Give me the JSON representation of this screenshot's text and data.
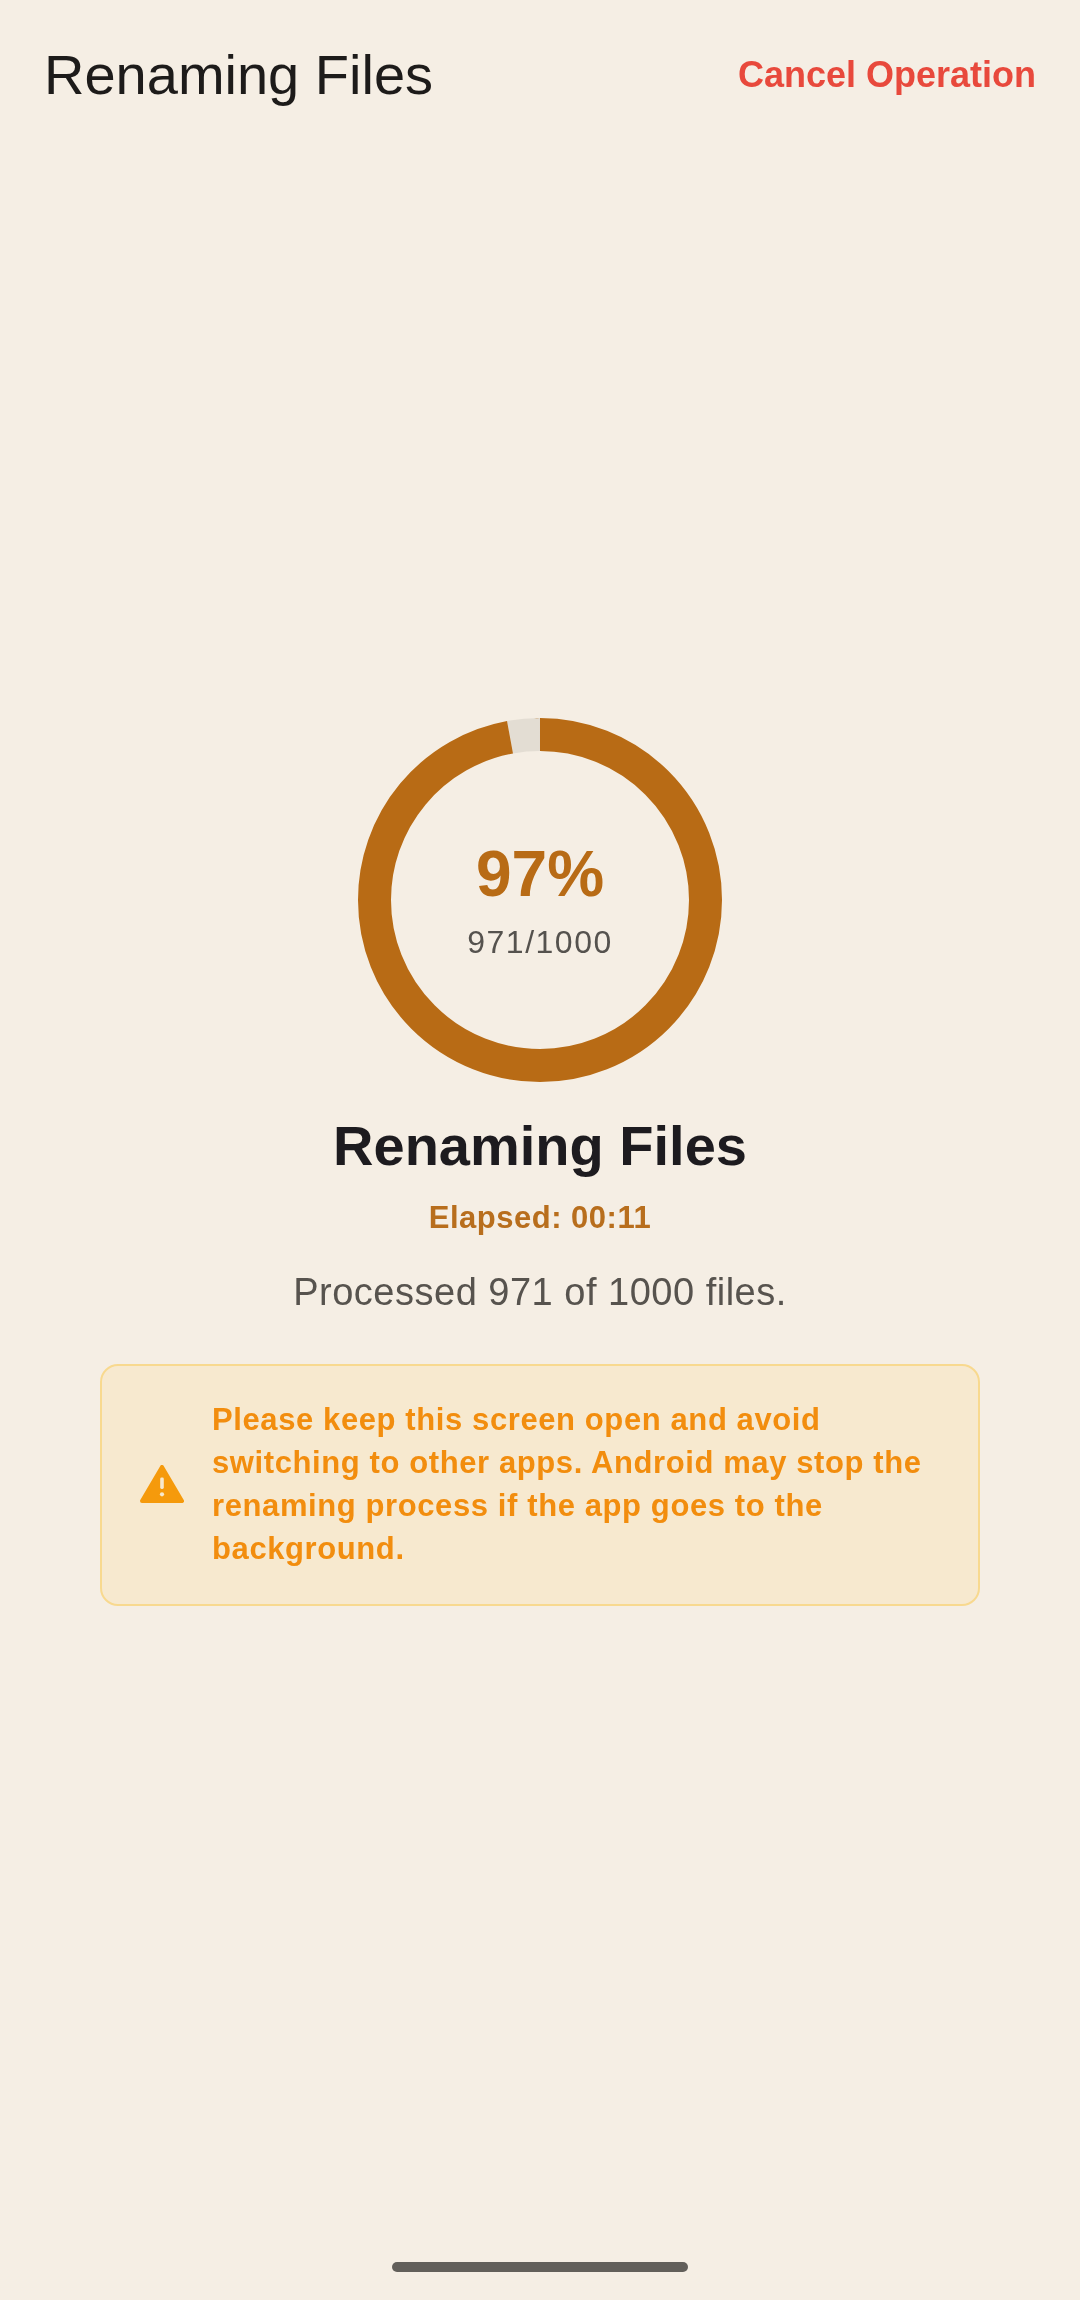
{
  "app_bar": {
    "title": "Renaming Files",
    "cancel_button": "Cancel Operation"
  },
  "progress_ring": {
    "level": 0.971,
    "percent": "97%",
    "count": "971/1000"
  },
  "status": {
    "title": "Renaming Files",
    "elapsed": "Elapsed: 00:11",
    "summary": "Processed 971 of 1000 files."
  },
  "warning_banner": {
    "text": "Please keep this screen open and avoid switching to other apps. Android may stop the renaming process if the app goes to the background."
  }
}
